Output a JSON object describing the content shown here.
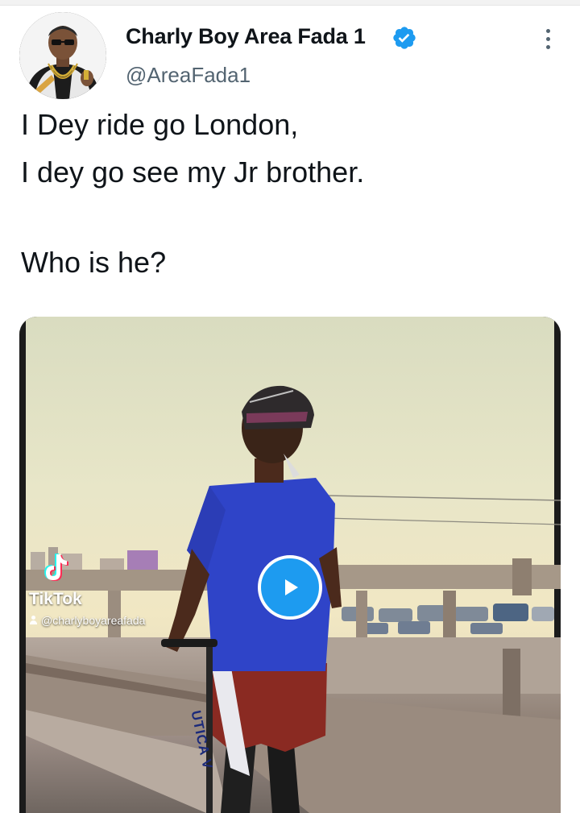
{
  "author": {
    "name": "Charly Boy Area Fada 1",
    "handle": "@AreaFada1",
    "verified": true
  },
  "tweet": {
    "lines": [
      "I Dey ride go London,",
      "I dey go see my Jr brother.",
      "",
      "Who is he?"
    ]
  },
  "media": {
    "type": "video",
    "watermark": {
      "brand": "TikTok",
      "handle": "@charlyboyareafada"
    },
    "jersey_text": "UTICA V"
  },
  "icons": {
    "verified": "verified-badge-icon",
    "more": "more-options-icon",
    "play": "play-icon",
    "tiktok": "tiktok-logo-icon"
  },
  "colors": {
    "accent": "#1d9bf0",
    "text": "#0f1419",
    "secondary_text": "#536471"
  }
}
